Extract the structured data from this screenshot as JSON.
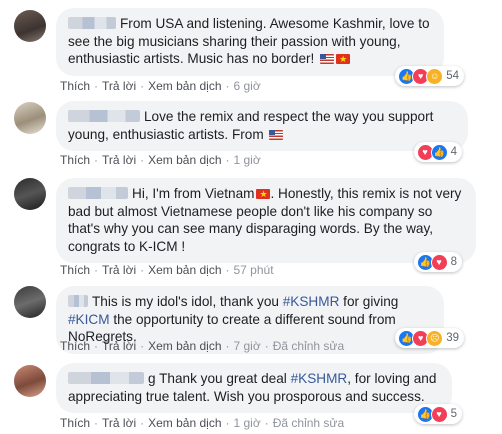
{
  "actions": {
    "like": "Thích",
    "reply": "Trả lời",
    "translate": "Xem bản dịch",
    "edited": "Đã chỉnh sửa",
    "sep": "·"
  },
  "comments": [
    {
      "text": "From USA and listening. Awesome Kashmir, love to see the big musicians sharing their passion with young, enthusiastic artists. Music has no border!",
      "time": "6 giờ",
      "reactions": [
        "like-icon",
        "love-icon",
        "haha-icon"
      ],
      "count": "54"
    },
    {
      "text": "Love the remix and respect the way you support young, enthusiastic artists. From",
      "time": "1 giờ",
      "reactions": [
        "love-icon",
        "like-icon"
      ],
      "count": "4"
    },
    {
      "text": "Hi, I'm from Vietnam",
      "text2": ". Honestly, this remix is not very bad but almost Vietnamese people don't like his company so that's why you can see many disparaging words. By the way, congrats to K-ICM !",
      "time": "57 phút",
      "reactions": [
        "like-icon",
        "love-icon"
      ],
      "count": "8"
    },
    {
      "text1": "This is my idol's idol, thank you",
      "tag1": "#KSHMR",
      "text2": "for giving",
      "tag2": "#KICM",
      "text3": "the opportunity to create a different sound from NoRegrets.",
      "time": "7 giờ",
      "reactions": [
        "like-icon",
        "love-icon",
        "wow-icon"
      ],
      "count": "39"
    },
    {
      "text1": "g Thank you great deal",
      "tag1": "#KSHMR",
      "text2": ", for loving and appreciating true talent. Wish you prosporous and success.",
      "time": "1 giờ",
      "reactions": [
        "like-icon",
        "love-icon"
      ],
      "count": "5"
    }
  ]
}
